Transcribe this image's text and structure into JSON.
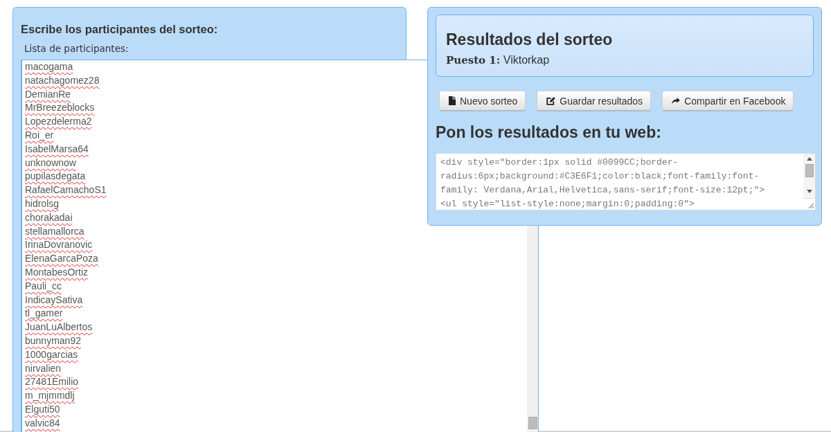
{
  "participants_panel": {
    "heading": "Escribe los participantes del sorteo:",
    "label": "Lista de participantes:",
    "entries": [
      "macogama",
      "natachagomez28",
      "DemianRe",
      "MrBreezeblocks",
      "Lopezdelerma2",
      "Roi_er",
      "IsabelMarsa64",
      "unknownow",
      "pupilasdegata",
      "RafaelCamachoS1",
      "hidrolsg",
      "chorakadai",
      "stellamallorca",
      "IrinaDovranovic",
      "ElenaGarcaPoza",
      "MontabesOrtiz",
      "Pauli_cc",
      "IndicaySativa",
      "tl_gamer",
      "JuanLuAlbertos",
      "bunnyman92",
      "1000garcias",
      "nirvalien",
      "27481Emilio",
      "m_mjmmdlj",
      "Elguti50",
      "valvic84"
    ]
  },
  "results_panel": {
    "title": "Resultados del sorteo",
    "places": [
      "**Puesto 1:** Viktorkap"
    ],
    "buttons": [
      {
        "kind": "new",
        "label": "Nuevo sorteo"
      },
      {
        "kind": "save",
        "label": "Guardar resultados"
      },
      {
        "kind": "share",
        "label": "Compartir en Facebook"
      }
    ],
    "embed_heading": "Pon los resultados en tu web:",
    "embed_code_lines": [
      "<div style=\"border:1px solid #0099CC;border-",
      "radius:6px;background:#C3E6F1;color:black;font-family:font-",
      "family: Verdana,Arial,Helvetica,sans-serif;font-size:12pt;\">",
      "<ul style=\"list-style:none;margin:0;padding:0\">"
    ]
  }
}
